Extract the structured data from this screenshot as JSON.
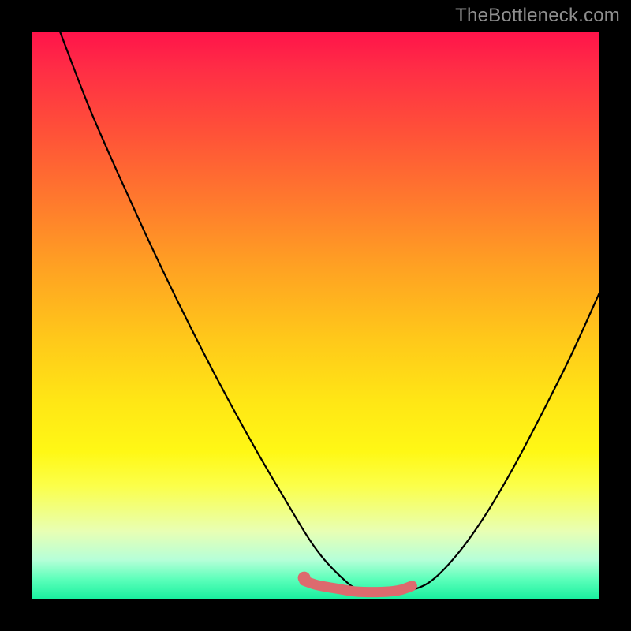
{
  "watermark": "TheBottleneck.com",
  "colors": {
    "page_bg": "#000000",
    "gradient_top": "#ff134a",
    "gradient_bottom": "#17ef9e",
    "curve_stroke": "#000000",
    "flat_segment_stroke": "#dd6a6e",
    "flat_segment_dot": "#dd6a6e",
    "watermark_color": "#8f8f8f"
  },
  "chart_data": {
    "type": "line",
    "title": "",
    "xlabel": "",
    "ylabel": "",
    "xlim": [
      0,
      100
    ],
    "ylim": [
      0,
      100
    ],
    "grid": false,
    "legend_position": "none",
    "annotations": [
      "TheBottleneck.com"
    ],
    "series": [
      {
        "name": "bottleneck-curve",
        "x": [
          5,
          10,
          15,
          20,
          25,
          30,
          35,
          40,
          45,
          48,
          50,
          52,
          55,
          57,
          60,
          65,
          70,
          75,
          80,
          85,
          90,
          95,
          100
        ],
        "y": [
          100,
          87,
          75.5,
          64.5,
          54,
          44,
          34.5,
          25.5,
          17,
          12,
          9,
          6.5,
          3.5,
          2,
          1.3,
          1.3,
          3,
          8,
          15,
          23.5,
          33,
          43,
          54
        ]
      },
      {
        "name": "flat-bottom-highlight",
        "x": [
          48,
          50,
          52,
          55,
          57,
          60,
          63,
          65,
          67
        ],
        "y": [
          3.3,
          2.6,
          2.2,
          1.7,
          1.4,
          1.3,
          1.4,
          1.7,
          2.4
        ]
      }
    ],
    "highlight_dot": {
      "x": 48,
      "y": 3.8
    }
  }
}
